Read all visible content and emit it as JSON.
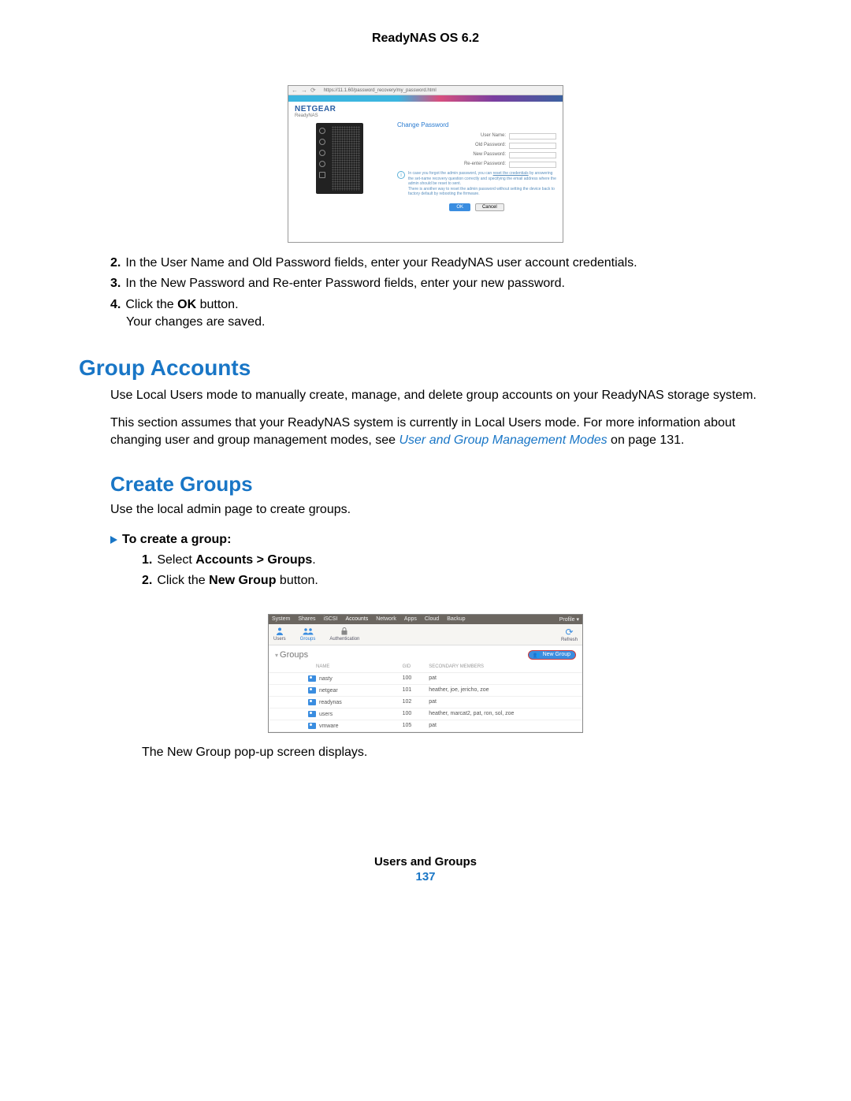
{
  "header": {
    "title": "ReadyNAS OS 6.2"
  },
  "screenshot1": {
    "url": "https://11.1.60/password_recovery/my_password.html",
    "brand": "NETGEAR",
    "sub": "ReadyNAS",
    "heading": "Change Password",
    "fields": {
      "username": "User Name:",
      "oldpw": "Old Password:",
      "newpw": "New Password:",
      "repw": "Re-enter Password:"
    },
    "info1": "In case you forgot the admin password, you can ",
    "info1_link": "reset the credentials",
    "info1_rest": " by answering the set-name recovery question correctly and specifying the email address where the admin should be reset to sent.",
    "info2": "There is another way to reset the admin password without setting the device back to factory default by rebooting the firmware.",
    "ok": "OK",
    "cancel": "Cancel"
  },
  "steps_a": [
    {
      "n": "2.",
      "text_pre": "In the User Name and Old Password fields, enter your ReadyNAS user account credentials."
    },
    {
      "n": "3.",
      "text_pre": "In the New Password and Re-enter Password fields, enter your new password."
    },
    {
      "n": "4.",
      "text_pre": "Click the ",
      "bold": "OK",
      "text_post": " button.",
      "sub": "Your changes are saved."
    }
  ],
  "section1": {
    "title": "Group Accounts",
    "p1": "Use Local Users mode to manually create, manage, and delete group accounts on your ReadyNAS storage system.",
    "p2_a": "This section assumes that your ReadyNAS system is currently in Local Users mode. For more information about changing user and group management modes, see ",
    "p2_link": "User and Group Management Modes",
    "p2_b": " on page 131."
  },
  "section2": {
    "title": "Create Groups",
    "p1": "Use the local admin page to create groups.",
    "proc": "To create a group:",
    "steps": [
      {
        "n": "1.",
        "pre": "Select ",
        "bold": "Accounts > Groups",
        "post": "."
      },
      {
        "n": "2.",
        "pre": "Click the ",
        "bold": "New Group",
        "post": " button."
      }
    ],
    "after": "The New Group pop-up screen displays."
  },
  "screenshot2": {
    "nav": [
      "System",
      "Shares",
      "iSCSI",
      "Accounts",
      "Network",
      "Apps",
      "Cloud",
      "Backup"
    ],
    "nav_right": "Profile ▾",
    "nav_active": "Accounts",
    "subnav": {
      "users": "Users",
      "groups": "Groups",
      "auth": "Authentication",
      "refresh": "Refresh"
    },
    "panel_title": "Groups",
    "new_group": "New Group",
    "columns": [
      "NAME",
      "GID",
      "SECONDARY MEMBERS"
    ],
    "rows": [
      {
        "name": "nasty",
        "gid": "100",
        "sec": "pat"
      },
      {
        "name": "netgear",
        "gid": "101",
        "sec": "heather, joe, jericho, zoe"
      },
      {
        "name": "readynas",
        "gid": "102",
        "sec": "pat"
      },
      {
        "name": "users",
        "gid": "100",
        "sec": "heather, marcat2, pat, ron, sol, zoe"
      },
      {
        "name": "vmware",
        "gid": "105",
        "sec": "pat"
      }
    ]
  },
  "footer": {
    "title": "Users and Groups",
    "page": "137"
  }
}
